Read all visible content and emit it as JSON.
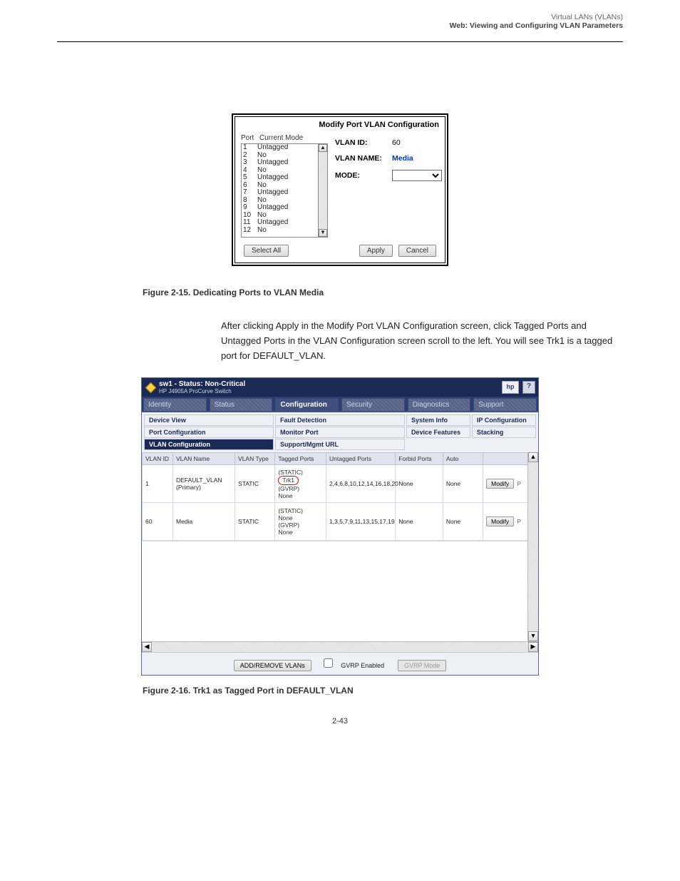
{
  "header": {
    "right_line1": "Virtual LANs (VLANs)",
    "right_line2": "Web: Viewing and Configuring VLAN Parameters"
  },
  "dialog1": {
    "title": "Modify Port VLAN Configuration",
    "col_port": "Port",
    "col_mode": "Current Mode",
    "rows": [
      {
        "port": "1",
        "mode": "Untagged"
      },
      {
        "port": "2",
        "mode": "No"
      },
      {
        "port": "3",
        "mode": "Untagged"
      },
      {
        "port": "4",
        "mode": "No"
      },
      {
        "port": "5",
        "mode": "Untagged"
      },
      {
        "port": "6",
        "mode": "No"
      },
      {
        "port": "7",
        "mode": "Untagged"
      },
      {
        "port": "8",
        "mode": "No"
      },
      {
        "port": "9",
        "mode": "Untagged"
      },
      {
        "port": "10",
        "mode": "No"
      },
      {
        "port": "11",
        "mode": "Untagged"
      },
      {
        "port": "12",
        "mode": "No"
      }
    ],
    "vlan_id_label": "VLAN ID:",
    "vlan_id_value": "60",
    "vlan_name_label": "VLAN NAME:",
    "vlan_name_value": "Media",
    "mode_label": "MODE:",
    "mode_value": "",
    "btn_select_all": "Select All",
    "btn_apply": "Apply",
    "btn_cancel": "Cancel"
  },
  "caption1": "Figure 2-15. Dedicating Ports to VLAN Media",
  "midtext": "After clicking Apply in the Modify Port VLAN Configuration screen, click Tagged Ports and Untagged Ports in the VLAN Configuration screen scroll to the left. You will see Trk1 is a tagged port for DEFAULT_VLAN.",
  "app": {
    "title_line1": "sw1 - Status: Non-Critical",
    "title_line2": "HP J4905A ProCurve Switch",
    "logo_text": "hp",
    "help_text": "?",
    "main_tabs": [
      "Identity",
      "Status",
      "Configuration",
      "Security",
      "Diagnostics",
      "Support"
    ],
    "main_tab_active_index": 2,
    "sub_cols": [
      [
        "Device View",
        "Port Configuration",
        "VLAN Configuration"
      ],
      [
        "Fault Detection",
        "Monitor Port",
        "Support/Mgmt URL"
      ],
      [
        "System Info",
        "Device Features",
        ""
      ],
      [
        "IP Configuration",
        "Stacking",
        ""
      ]
    ],
    "sub_active": "VLAN Configuration",
    "grid_headers": [
      "VLAN ID",
      "VLAN Name",
      "VLAN Type",
      "Tagged Ports",
      "Untagged Ports",
      "Forbid Ports",
      "Auto",
      ""
    ],
    "grid_rows": [
      {
        "id": "1",
        "name": "DEFAULT_VLAN (Primary)",
        "type": "STATIC",
        "tagged": {
          "static_label": "(STATIC)",
          "static_val": "Trk1",
          "gvrp_label": "(GVRP)",
          "gvrp_val": "None"
        },
        "untagged": "2,4,6,8,10,12,14,16,18,20",
        "forbid": "None",
        "auto": "None",
        "modify": "Modify",
        "p": "P"
      },
      {
        "id": "60",
        "name": "Media",
        "type": "STATIC",
        "tagged": {
          "static_label": "(STATIC)",
          "static_val": "None",
          "gvrp_label": "(GVRP)",
          "gvrp_val": "None"
        },
        "untagged": "1,3,5,7,9,11,13,15,17,19",
        "forbid": "None",
        "auto": "None",
        "modify": "Modify",
        "p": "P"
      }
    ],
    "footer": {
      "add_remove": "ADD/REMOVE VLANs",
      "gvrp_chk": "GVRP Enabled",
      "gvrp_btn": "GVRP Mode"
    }
  },
  "caption2": "Figure 2-16. Trk1 as Tagged Port in DEFAULT_VLAN",
  "page_num": "2-43"
}
